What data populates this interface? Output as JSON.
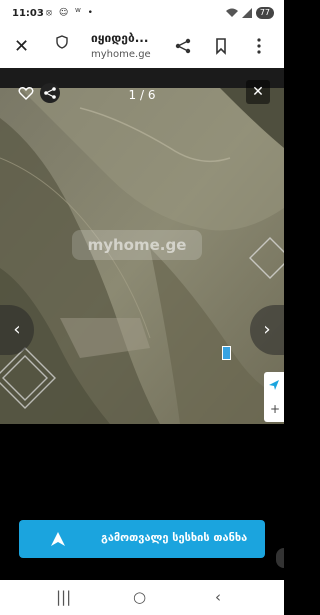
{
  "status_bar": {
    "time": "11:03",
    "notification_icons": [
      "⦻",
      "☺",
      "ᵂ",
      "•"
    ],
    "battery": "77"
  },
  "browser": {
    "title": "იყიდებ...",
    "url": "myhome.ge"
  },
  "viewer": {
    "counter": "1 / 6",
    "watermark": "myhome.ge"
  },
  "cta": {
    "label": "გამოთვალე სესხის თანხა"
  },
  "colors": {
    "accent": "#1ba4de"
  }
}
